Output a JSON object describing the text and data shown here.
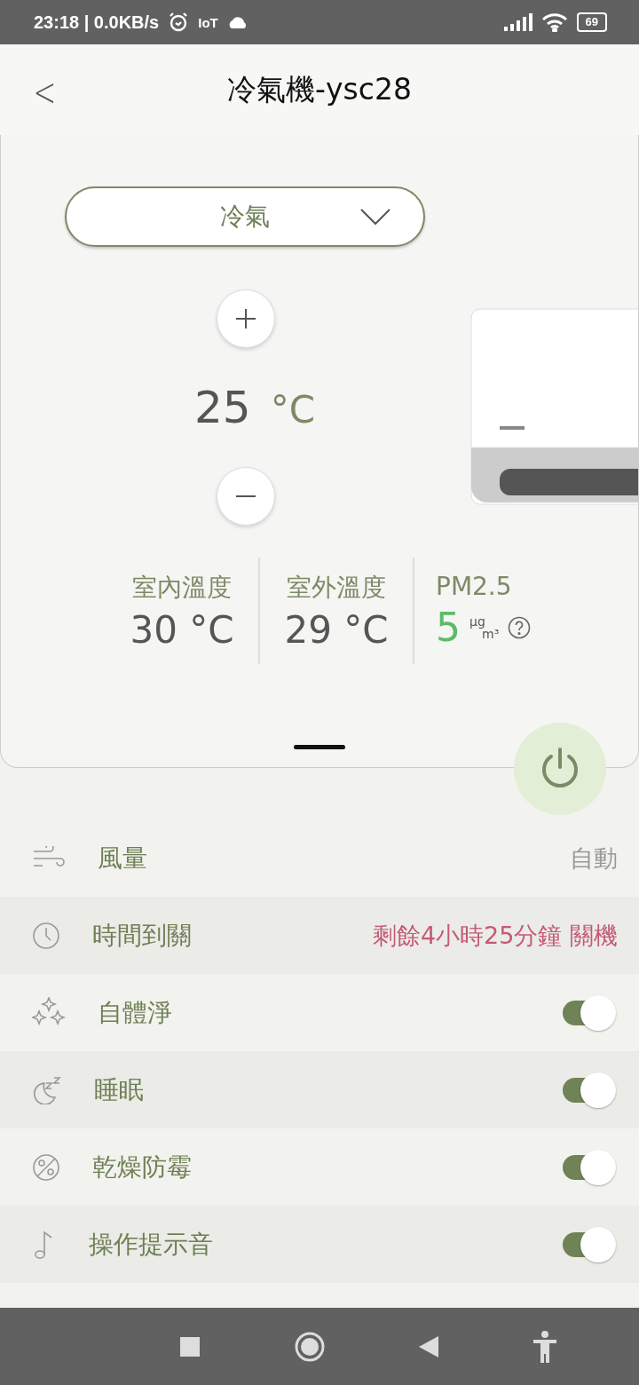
{
  "status_bar": {
    "time": "23:18 | 0.0KB/s",
    "iot": "IoT",
    "battery": "69"
  },
  "header": {
    "back": "<",
    "title": "冷氣機-ysc28"
  },
  "mode": {
    "value": "冷氣"
  },
  "temperature": {
    "value": "25",
    "unit": "°C"
  },
  "stats": [
    {
      "label": "室內溫度",
      "value": "30 °C"
    },
    {
      "label": "室外溫度",
      "value": "29 °C"
    },
    {
      "label": "PM2.5",
      "value": "5",
      "unit_top": "µg",
      "unit_bottom": "m³"
    }
  ],
  "power": {
    "on": true
  },
  "settings": [
    {
      "kind": "value",
      "label": "風量",
      "value": "自動",
      "color": "#999999"
    },
    {
      "kind": "value",
      "label": "時間到關",
      "value": "剩餘4小時25分鐘 關機",
      "color": "#c55a78"
    },
    {
      "kind": "toggle",
      "label": "自體淨",
      "on": true
    },
    {
      "kind": "toggle",
      "label": "睡眠",
      "on": true
    },
    {
      "kind": "toggle",
      "label": "乾燥防霉",
      "on": true
    },
    {
      "kind": "toggle",
      "label": "操作提示音",
      "on": true
    }
  ]
}
